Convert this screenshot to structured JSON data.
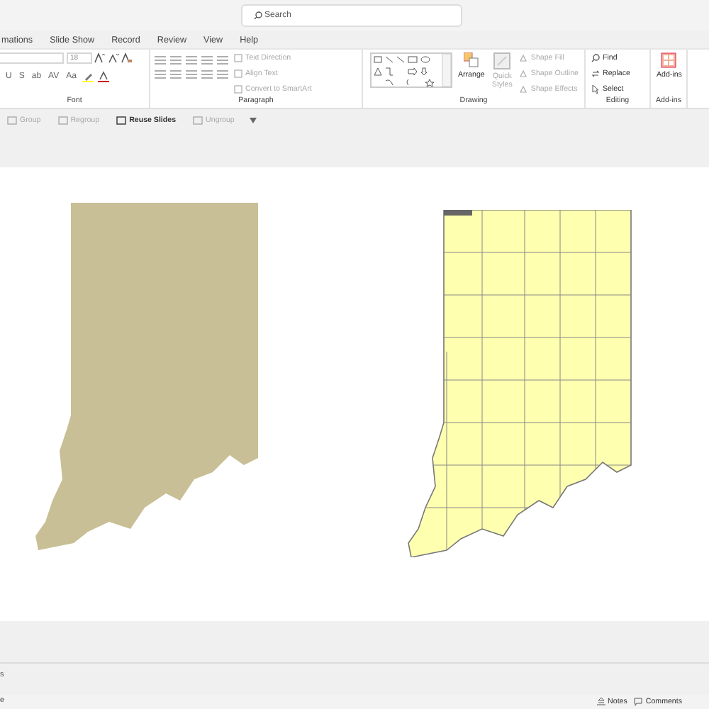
{
  "search": {
    "placeholder": "Search"
  },
  "tabs": [
    {
      "label": "mations",
      "selected": false
    },
    {
      "label": "Slide Show",
      "selected": false
    },
    {
      "label": "Record",
      "selected": false
    },
    {
      "label": "Review",
      "selected": false
    },
    {
      "label": "View",
      "selected": false
    },
    {
      "label": "Help",
      "selected": false
    }
  ],
  "font_group": {
    "label": "Font",
    "size": "18",
    "format_buttons": [
      "U",
      "S",
      "ab",
      "AV",
      "Aa"
    ]
  },
  "paragraph_group": {
    "label": "Paragraph",
    "commands": [
      {
        "label": "Text Direction",
        "disabled": true
      },
      {
        "label": "Align Text",
        "disabled": true
      },
      {
        "label": "Convert to SmartArt",
        "disabled": true
      }
    ]
  },
  "drawing_group": {
    "label": "Drawing",
    "arrange": {
      "label": "Arrange",
      "disabled": false
    },
    "quick_styles": {
      "label": "Quick Styles",
      "disabled": true
    },
    "commands": [
      {
        "label": "Shape Fill",
        "disabled": true
      },
      {
        "label": "Shape Outline",
        "disabled": true
      },
      {
        "label": "Shape Effects",
        "disabled": true
      }
    ]
  },
  "editing_group": {
    "label": "Editing",
    "commands": [
      {
        "kind": "find",
        "label": "Find"
      },
      {
        "kind": "replace",
        "label": "Replace"
      },
      {
        "kind": "select",
        "label": "Select"
      }
    ]
  },
  "addins_group": {
    "label": "Add-ins",
    "button": "Add-ins"
  },
  "quick_access": [
    {
      "label": "Group",
      "disabled": true
    },
    {
      "label": "Regroup",
      "disabled": true
    },
    {
      "label": "Reuse Slides",
      "disabled": false
    },
    {
      "label": "Ungroup",
      "disabled": true
    }
  ],
  "slide": {
    "shapes": [
      {
        "kind": "silhouette",
        "color": "#c8bf96"
      },
      {
        "kind": "picture"
      }
    ]
  },
  "notes_fragment": "s",
  "status_bar": {
    "left": "e",
    "buttons": [
      "Notes",
      "Comments"
    ]
  }
}
